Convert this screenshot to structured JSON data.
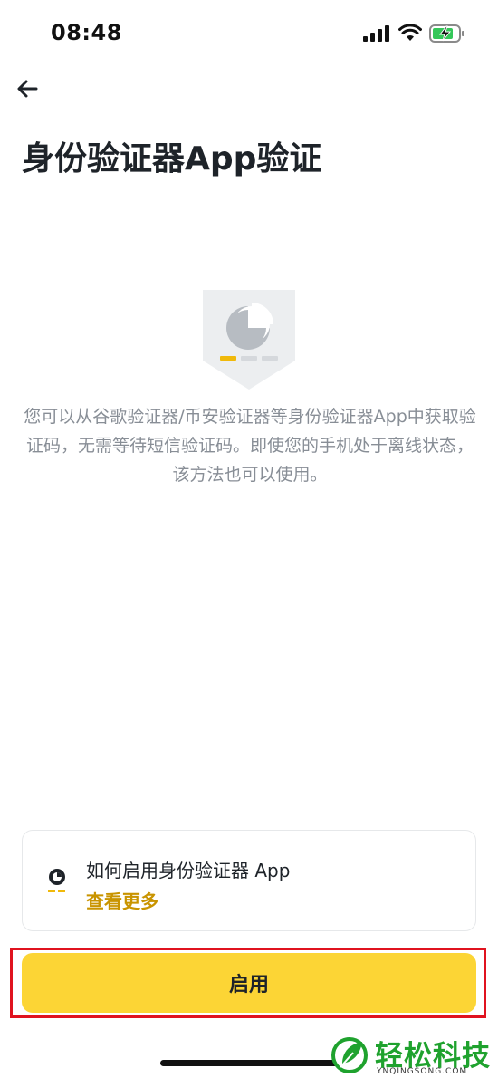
{
  "status_bar": {
    "time": "08:48",
    "icons": [
      "cellular-signal-icon",
      "wifi-icon",
      "battery-charging-icon"
    ]
  },
  "header": {
    "back_icon": "arrow-left-icon",
    "title": "身份验证器App验证"
  },
  "illustration": {
    "icon": "authenticator-shield-icon",
    "colors": {
      "accent": "#f0b90b",
      "muted": "#d5d8dc",
      "shield": "#eceef0"
    }
  },
  "description": "您可以从谷歌验证器/币安验证器等身份验证器App中获取验证码，无需等待短信验证码。即使您的手机处于离线状态，该方法也可以使用。",
  "help_card": {
    "icon": "guide-icon",
    "title": "如何启用身份验证器 App",
    "link": "查看更多"
  },
  "primary_button": {
    "label": "启用",
    "color": "#fcd535"
  },
  "highlight_color": "#e0131f",
  "watermark": {
    "text": "轻松科技",
    "subtext": "YNQINGSONG.COM"
  }
}
